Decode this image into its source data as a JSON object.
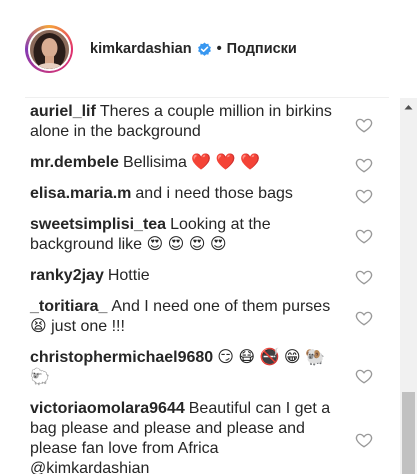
{
  "header": {
    "username": "kimkardashian",
    "separator": "•",
    "follow_label": "Подписки"
  },
  "comments": [
    {
      "author": "auriel_lif",
      "text": "Theres a couple million in birkins alone in the background"
    },
    {
      "author": "mr.dembele",
      "text": "Bellisima ❤️ ❤️ ❤️"
    },
    {
      "author": "elisa.maria.m",
      "text": "and i need those bags"
    },
    {
      "author": "sweetsimplisi_tea",
      "text": "Looking at the background like 😍 😍 😍 😍"
    },
    {
      "author": "ranky2jay",
      "text": "Hottie"
    },
    {
      "author": "_toritiara_",
      "text": "And I need one of them purses 😫 just one !!!"
    },
    {
      "author": "christophermichael9680",
      "text": "😏 😷 🚭 😁 🐏 🐑"
    },
    {
      "author": "victoriaomolara9644",
      "text": "Beautiful can I get a bag please and please and please and please fan love from Africa @kimkardashian"
    }
  ],
  "icons": {
    "verified": "verified-badge-icon",
    "like": "heart-outline-icon",
    "scroll_up": "scroll-up-arrow-icon"
  },
  "colors": {
    "verified_blue": "#3897f0",
    "heart_outline": "#999999",
    "text": "#262626"
  }
}
